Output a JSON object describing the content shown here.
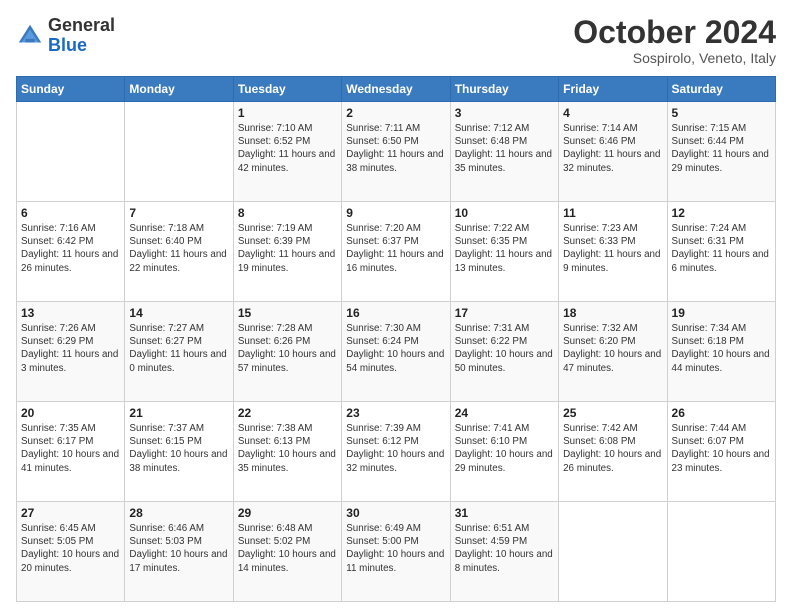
{
  "header": {
    "logo_general": "General",
    "logo_blue": "Blue",
    "month": "October 2024",
    "location": "Sospirolo, Veneto, Italy"
  },
  "weekdays": [
    "Sunday",
    "Monday",
    "Tuesday",
    "Wednesday",
    "Thursday",
    "Friday",
    "Saturday"
  ],
  "weeks": [
    [
      {
        "day": null
      },
      {
        "day": null
      },
      {
        "day": "1",
        "sunrise": "Sunrise: 7:10 AM",
        "sunset": "Sunset: 6:52 PM",
        "daylight": "Daylight: 11 hours and 42 minutes."
      },
      {
        "day": "2",
        "sunrise": "Sunrise: 7:11 AM",
        "sunset": "Sunset: 6:50 PM",
        "daylight": "Daylight: 11 hours and 38 minutes."
      },
      {
        "day": "3",
        "sunrise": "Sunrise: 7:12 AM",
        "sunset": "Sunset: 6:48 PM",
        "daylight": "Daylight: 11 hours and 35 minutes."
      },
      {
        "day": "4",
        "sunrise": "Sunrise: 7:14 AM",
        "sunset": "Sunset: 6:46 PM",
        "daylight": "Daylight: 11 hours and 32 minutes."
      },
      {
        "day": "5",
        "sunrise": "Sunrise: 7:15 AM",
        "sunset": "Sunset: 6:44 PM",
        "daylight": "Daylight: 11 hours and 29 minutes."
      }
    ],
    [
      {
        "day": "6",
        "sunrise": "Sunrise: 7:16 AM",
        "sunset": "Sunset: 6:42 PM",
        "daylight": "Daylight: 11 hours and 26 minutes."
      },
      {
        "day": "7",
        "sunrise": "Sunrise: 7:18 AM",
        "sunset": "Sunset: 6:40 PM",
        "daylight": "Daylight: 11 hours and 22 minutes."
      },
      {
        "day": "8",
        "sunrise": "Sunrise: 7:19 AM",
        "sunset": "Sunset: 6:39 PM",
        "daylight": "Daylight: 11 hours and 19 minutes."
      },
      {
        "day": "9",
        "sunrise": "Sunrise: 7:20 AM",
        "sunset": "Sunset: 6:37 PM",
        "daylight": "Daylight: 11 hours and 16 minutes."
      },
      {
        "day": "10",
        "sunrise": "Sunrise: 7:22 AM",
        "sunset": "Sunset: 6:35 PM",
        "daylight": "Daylight: 11 hours and 13 minutes."
      },
      {
        "day": "11",
        "sunrise": "Sunrise: 7:23 AM",
        "sunset": "Sunset: 6:33 PM",
        "daylight": "Daylight: 11 hours and 9 minutes."
      },
      {
        "day": "12",
        "sunrise": "Sunrise: 7:24 AM",
        "sunset": "Sunset: 6:31 PM",
        "daylight": "Daylight: 11 hours and 6 minutes."
      }
    ],
    [
      {
        "day": "13",
        "sunrise": "Sunrise: 7:26 AM",
        "sunset": "Sunset: 6:29 PM",
        "daylight": "Daylight: 11 hours and 3 minutes."
      },
      {
        "day": "14",
        "sunrise": "Sunrise: 7:27 AM",
        "sunset": "Sunset: 6:27 PM",
        "daylight": "Daylight: 11 hours and 0 minutes."
      },
      {
        "day": "15",
        "sunrise": "Sunrise: 7:28 AM",
        "sunset": "Sunset: 6:26 PM",
        "daylight": "Daylight: 10 hours and 57 minutes."
      },
      {
        "day": "16",
        "sunrise": "Sunrise: 7:30 AM",
        "sunset": "Sunset: 6:24 PM",
        "daylight": "Daylight: 10 hours and 54 minutes."
      },
      {
        "day": "17",
        "sunrise": "Sunrise: 7:31 AM",
        "sunset": "Sunset: 6:22 PM",
        "daylight": "Daylight: 10 hours and 50 minutes."
      },
      {
        "day": "18",
        "sunrise": "Sunrise: 7:32 AM",
        "sunset": "Sunset: 6:20 PM",
        "daylight": "Daylight: 10 hours and 47 minutes."
      },
      {
        "day": "19",
        "sunrise": "Sunrise: 7:34 AM",
        "sunset": "Sunset: 6:18 PM",
        "daylight": "Daylight: 10 hours and 44 minutes."
      }
    ],
    [
      {
        "day": "20",
        "sunrise": "Sunrise: 7:35 AM",
        "sunset": "Sunset: 6:17 PM",
        "daylight": "Daylight: 10 hours and 41 minutes."
      },
      {
        "day": "21",
        "sunrise": "Sunrise: 7:37 AM",
        "sunset": "Sunset: 6:15 PM",
        "daylight": "Daylight: 10 hours and 38 minutes."
      },
      {
        "day": "22",
        "sunrise": "Sunrise: 7:38 AM",
        "sunset": "Sunset: 6:13 PM",
        "daylight": "Daylight: 10 hours and 35 minutes."
      },
      {
        "day": "23",
        "sunrise": "Sunrise: 7:39 AM",
        "sunset": "Sunset: 6:12 PM",
        "daylight": "Daylight: 10 hours and 32 minutes."
      },
      {
        "day": "24",
        "sunrise": "Sunrise: 7:41 AM",
        "sunset": "Sunset: 6:10 PM",
        "daylight": "Daylight: 10 hours and 29 minutes."
      },
      {
        "day": "25",
        "sunrise": "Sunrise: 7:42 AM",
        "sunset": "Sunset: 6:08 PM",
        "daylight": "Daylight: 10 hours and 26 minutes."
      },
      {
        "day": "26",
        "sunrise": "Sunrise: 7:44 AM",
        "sunset": "Sunset: 6:07 PM",
        "daylight": "Daylight: 10 hours and 23 minutes."
      }
    ],
    [
      {
        "day": "27",
        "sunrise": "Sunrise: 6:45 AM",
        "sunset": "Sunset: 5:05 PM",
        "daylight": "Daylight: 10 hours and 20 minutes."
      },
      {
        "day": "28",
        "sunrise": "Sunrise: 6:46 AM",
        "sunset": "Sunset: 5:03 PM",
        "daylight": "Daylight: 10 hours and 17 minutes."
      },
      {
        "day": "29",
        "sunrise": "Sunrise: 6:48 AM",
        "sunset": "Sunset: 5:02 PM",
        "daylight": "Daylight: 10 hours and 14 minutes."
      },
      {
        "day": "30",
        "sunrise": "Sunrise: 6:49 AM",
        "sunset": "Sunset: 5:00 PM",
        "daylight": "Daylight: 10 hours and 11 minutes."
      },
      {
        "day": "31",
        "sunrise": "Sunrise: 6:51 AM",
        "sunset": "Sunset: 4:59 PM",
        "daylight": "Daylight: 10 hours and 8 minutes."
      },
      {
        "day": null
      },
      {
        "day": null
      }
    ]
  ]
}
